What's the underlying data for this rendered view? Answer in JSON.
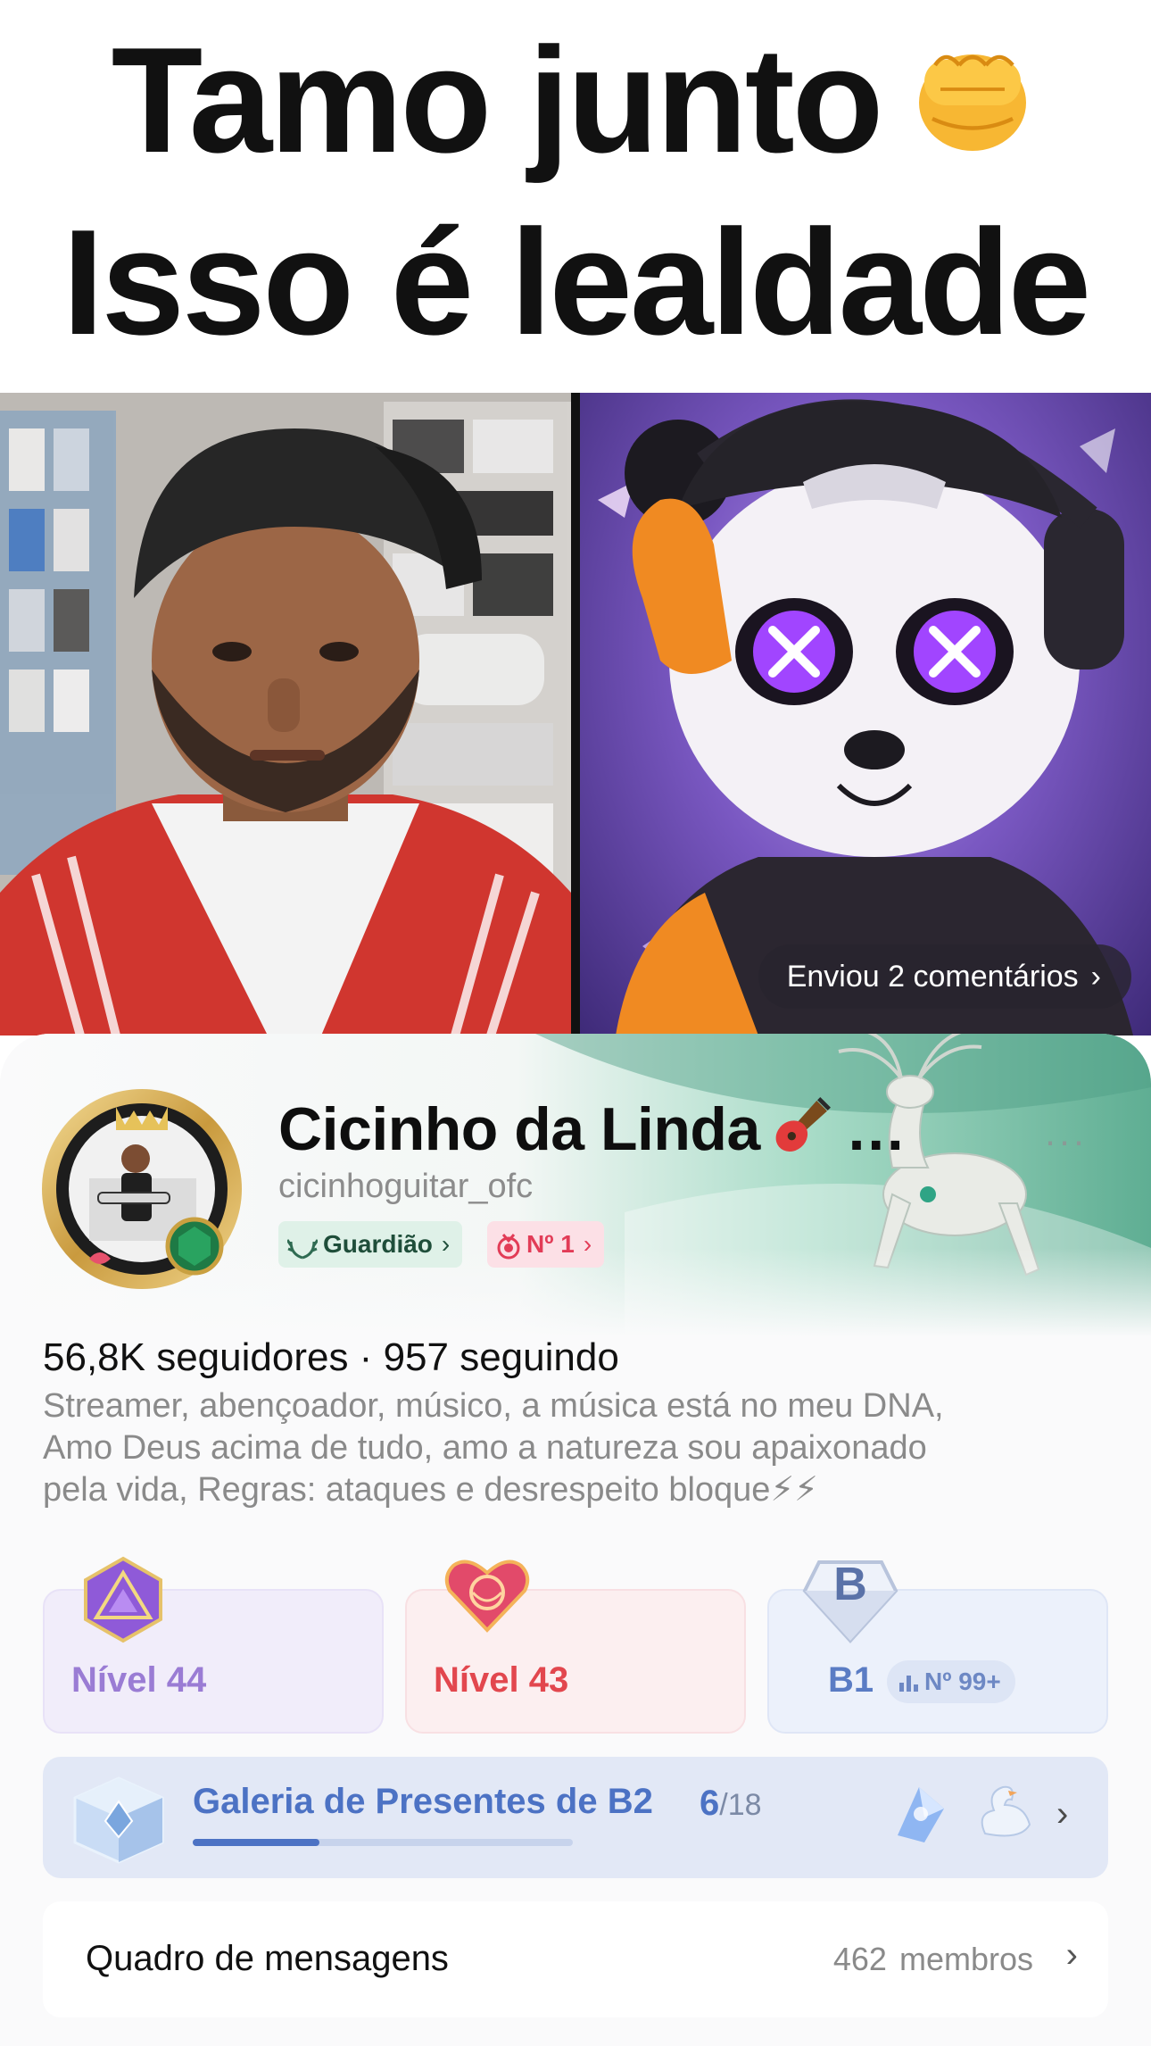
{
  "caption": {
    "line1": "Tamo junto",
    "line2": "Isso é lealdade"
  },
  "photos": {
    "comments_pill": "Enviou 2 comentários"
  },
  "profile": {
    "name": "Cicinho da Linda",
    "name_ellipsis": "…",
    "more": "···",
    "handle": "cicinhoguitar_ofc",
    "badges": {
      "guardian": "Guardião",
      "rank": "Nº 1"
    },
    "stats": "56,8K seguidores · 957 seguindo",
    "bio_lines": [
      "Streamer, abençoador, músico, a música está no meu DNA,",
      "Amo Deus acima de tudo, amo a natureza sou apaixonado",
      "pela vida, Regras: ataques e desrespeito bloque⚡⚡"
    ]
  },
  "levels": [
    {
      "label": "Nível 44"
    },
    {
      "label": "Nível 43"
    },
    {
      "label": "B1",
      "rank": "Nº 99+"
    }
  ],
  "gallery": {
    "title": "Galeria de Presentes de B2",
    "current": "6",
    "total": "/18",
    "progress_fraction": 0.333
  },
  "message_board": {
    "title": "Quadro de mensagens",
    "count": "462",
    "count_label": "membros"
  },
  "colors": {
    "accent_blue": "#4c72c4",
    "level_purple": "#9a7cd4",
    "level_red": "#e2474e",
    "guardian_green": "#1f4e3a",
    "rank_pink": "#e23c57"
  }
}
